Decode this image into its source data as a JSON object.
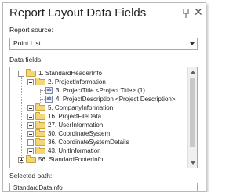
{
  "panel": {
    "title": "Report Layout Data Fields",
    "report_source_label": "Report source:",
    "report_source_value": "Point List",
    "data_fields_label": "Data fields:",
    "selected_path_label": "Selected path:",
    "selected_path_value": "StandardDataInfo"
  },
  "tree": {
    "n1": "1. StandardHeaderInfo",
    "n2": "2. ProjectInformation",
    "n3": "3. ProjectTitle  <Project Title> (1)",
    "n4": "4. ProjectDescription  <Project Description>",
    "n5": "5. CompanyInformation",
    "n16": "16. ProjectFileData",
    "n27": "27. UserInformation",
    "n30": "30. CoordinateSystem",
    "n36": "36. CoordinateSystemDetails",
    "n43": "43. UnitInformation",
    "n56": "56. StandardFooterInfo"
  },
  "icons": {
    "pin": "pin-icon",
    "close": "close-icon",
    "folder": "folder-icon",
    "field": "field-icon"
  },
  "colors": {
    "folder": "#f4d678",
    "field": "#34508a"
  }
}
